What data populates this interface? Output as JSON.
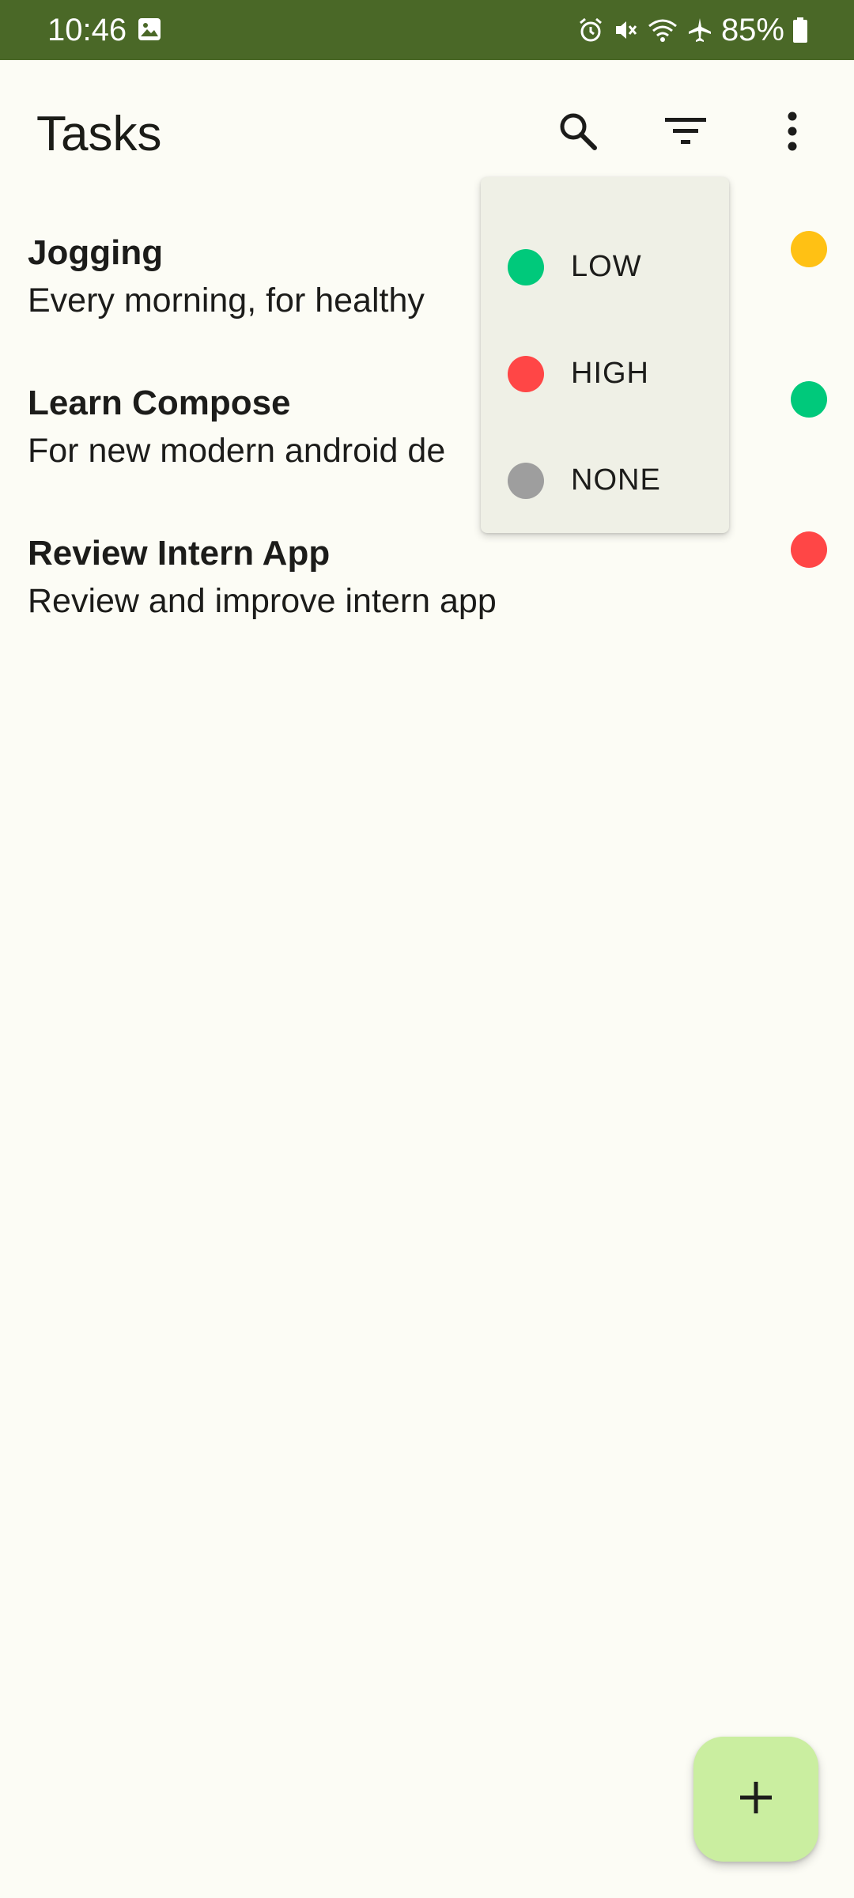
{
  "status_bar": {
    "time": "10:46",
    "battery": "85%",
    "icons": [
      "gallery-icon",
      "alarm-icon",
      "mute-icon",
      "wifi-icon",
      "airplane-icon",
      "battery-icon"
    ]
  },
  "app_bar": {
    "title": "Tasks",
    "actions": [
      "search-icon",
      "filter-icon",
      "more-vert-icon"
    ]
  },
  "colors": {
    "status_bar": "#4A6827",
    "background": "#FCFCF5",
    "menu_background": "#EFF0E6",
    "fab": "#CAEEA0",
    "priority_low": "#00C97B",
    "priority_medium": "#FFC114",
    "priority_high": "#FF4646",
    "priority_none": "#9E9E9E"
  },
  "tasks": [
    {
      "title": "Jogging",
      "description": "Every morning, for healthy",
      "priority_color": "#FFC114"
    },
    {
      "title": "Learn Compose",
      "description": "For new modern android de",
      "priority_color": "#00C97B"
    },
    {
      "title": "Review Intern App",
      "description": "Review and improve intern app",
      "priority_color": "#FF4646"
    }
  ],
  "priority_menu": [
    {
      "label": "LOW",
      "color": "#00C97B"
    },
    {
      "label": "HIGH",
      "color": "#FF4646"
    },
    {
      "label": "NONE",
      "color": "#9E9E9E"
    }
  ],
  "fab": {
    "icon": "add-icon"
  }
}
